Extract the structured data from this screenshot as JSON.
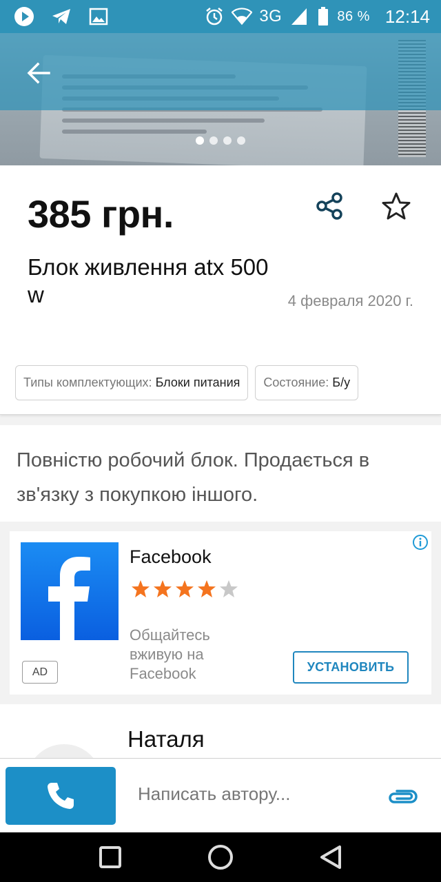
{
  "status_bar": {
    "network": "3G",
    "battery": "86 %",
    "time": "12:14",
    "icons": [
      "play-icon",
      "telegram-icon",
      "image-icon",
      "alarm-icon",
      "wifi-icon",
      "signal-icon",
      "battery-icon"
    ]
  },
  "colors": {
    "brand": "#2f93b8",
    "accent": "#1c8fc7",
    "star_active": "#f4741f",
    "star_inactive": "#c8c8c8"
  },
  "listing": {
    "price": "385 грн.",
    "title": "Блок живлення atx 500 w",
    "date": "4 февраля 2020 г.",
    "gallery_count": 4,
    "gallery_active": 1,
    "params": [
      {
        "key": "Типы комплектующих:",
        "value": "Блоки питания"
      },
      {
        "key": "Состояние:",
        "value": "Б/у"
      }
    ],
    "description": "Повністю робочий блок. Продається в зв'язку з покупкою іншого."
  },
  "ad": {
    "title": "Facebook",
    "rating": 4,
    "rating_max": 5,
    "text": "Общайтесь вживую на Facebook",
    "badge": "AD",
    "cta": "УСТАНОВИТЬ"
  },
  "seller": {
    "name": "Наталя"
  },
  "bottom_bar": {
    "message_placeholder": "Написать автору..."
  }
}
